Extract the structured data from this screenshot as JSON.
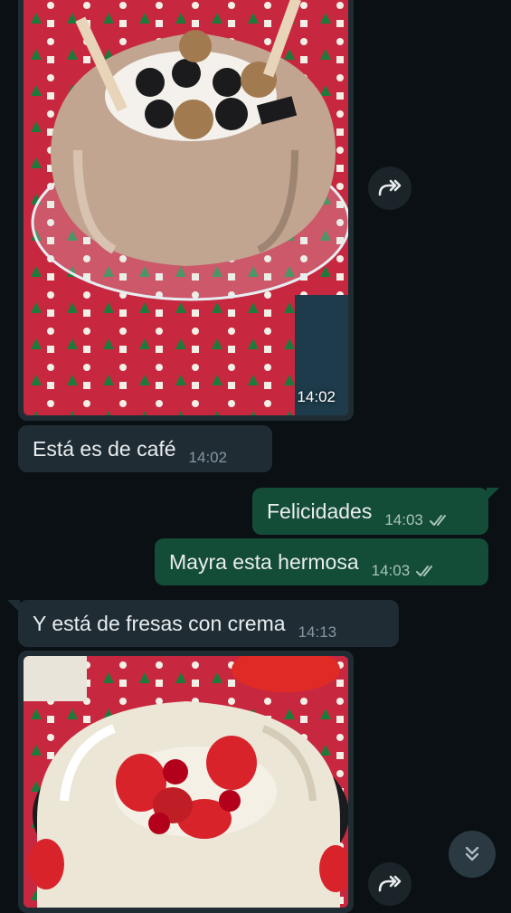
{
  "messages": [
    {
      "kind": "image",
      "time": "14:02"
    },
    {
      "kind": "text",
      "direction": "in",
      "text": "Está es de café",
      "time": "14:02"
    },
    {
      "kind": "text",
      "direction": "out",
      "text": "Felicidades",
      "time": "14:03"
    },
    {
      "kind": "text",
      "direction": "out",
      "text": "Mayra esta hermosa",
      "time": "14:03"
    },
    {
      "kind": "text",
      "direction": "in",
      "text": "Y está de fresas con crema",
      "time": "14:13"
    },
    {
      "kind": "image"
    }
  ],
  "icons": {
    "forward": "forward-icon",
    "scroll_down": "double-chevron-down-icon",
    "read_receipt": "double-check-icon"
  },
  "colors": {
    "background": "#0b1014",
    "incoming_bubble": "#1f2c33",
    "outgoing_bubble": "#144d37",
    "text": "#e9edef",
    "meta": "#8696a0"
  }
}
